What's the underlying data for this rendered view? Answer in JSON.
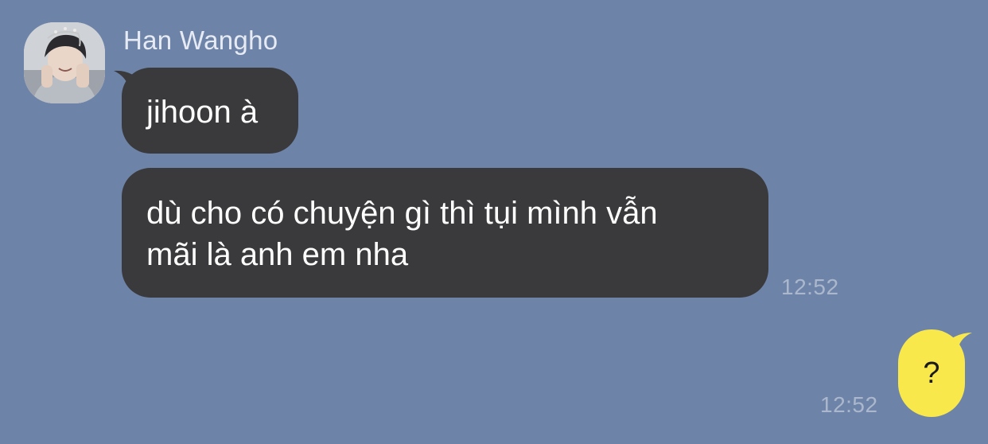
{
  "contact": {
    "name": "Han Wangho"
  },
  "messages": {
    "incoming_1": {
      "text": "jihoon à"
    },
    "incoming_2": {
      "line1": "dù cho có chuyện gì thì tụi mình vẫn",
      "line2": "mãi là anh em nha",
      "time": "12:52"
    },
    "outgoing_1": {
      "text": "?",
      "time": "12:52"
    }
  },
  "colors": {
    "background": "#6e83a8",
    "incoming_bubble": "#3a3a3c",
    "outgoing_bubble": "#f9e84c"
  }
}
